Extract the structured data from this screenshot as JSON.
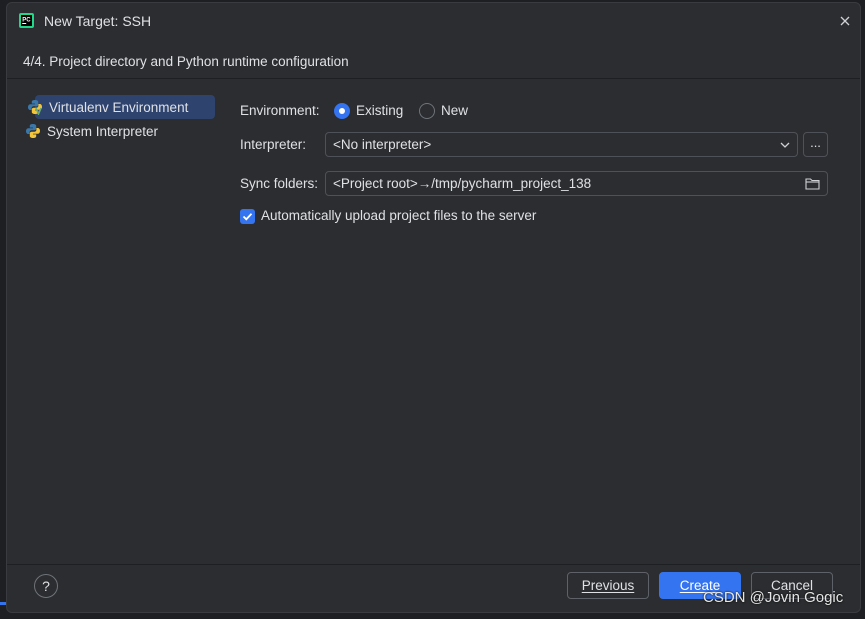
{
  "window": {
    "title": "New Target: SSH",
    "close_label": "×"
  },
  "step": {
    "title": "4/4. Project directory and Python runtime configuration"
  },
  "sidebar": {
    "items": [
      {
        "label": "Virtualenv Environment",
        "selected": true,
        "icon": "python-virtualenv-icon"
      },
      {
        "label": "System Interpreter",
        "selected": false,
        "icon": "python-icon"
      }
    ]
  },
  "form": {
    "environment": {
      "label": "Environment:",
      "options": [
        {
          "label": "Existing",
          "selected": true
        },
        {
          "label": "New",
          "selected": false
        }
      ]
    },
    "interpreter": {
      "label": "Interpreter:",
      "value": "<No interpreter>",
      "browse_label": "..."
    },
    "sync": {
      "label": "Sync folders:",
      "value": "<Project root>→/tmp/pycharm_project_138"
    },
    "auto_upload": {
      "label": "Automatically upload project files to the server",
      "checked": true
    }
  },
  "footer": {
    "help_label": "?",
    "previous_label": "Previous",
    "create_label": "Create",
    "cancel_label": "Cancel"
  },
  "watermark": "CSDN @Jovin Gogic",
  "colors": {
    "accent": "#3574f0",
    "background": "#2b2d30",
    "selection": "#2e436e"
  }
}
